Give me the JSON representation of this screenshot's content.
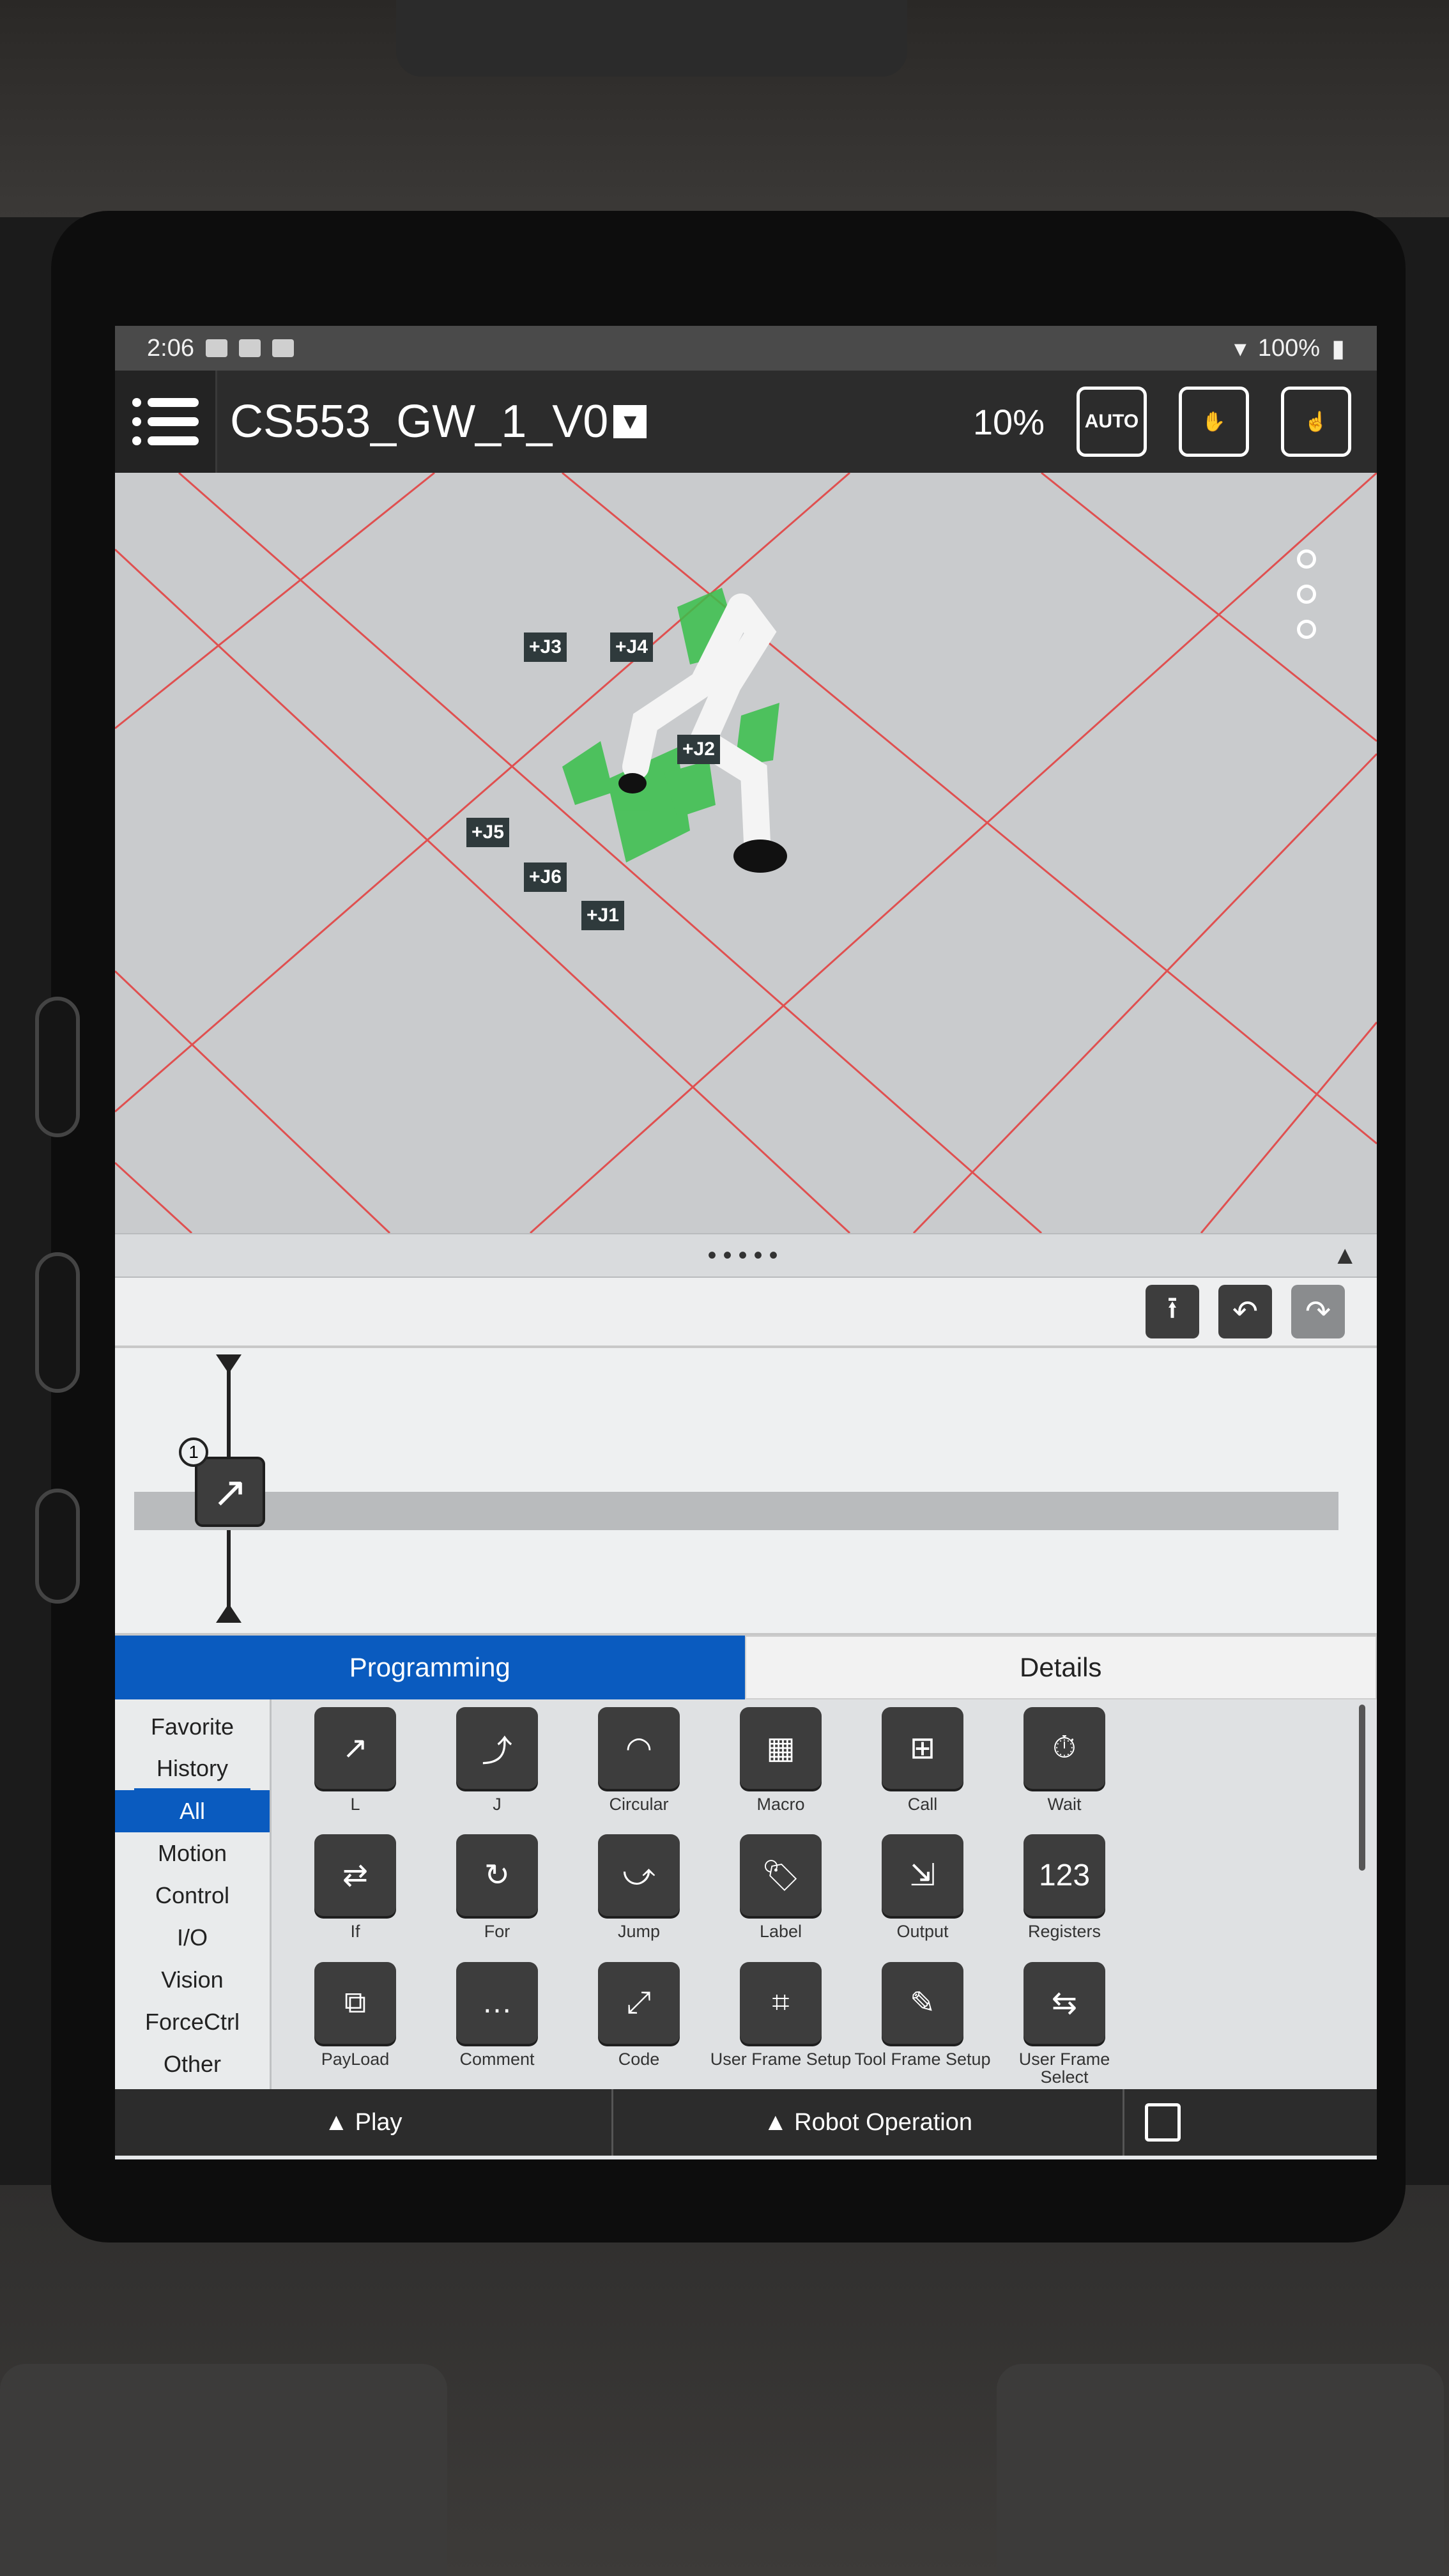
{
  "status_bar": {
    "time": "2:06",
    "battery": "100%"
  },
  "header": {
    "program_name": "CS553_GW_1_V0",
    "dropdown_glyph": "▼",
    "speed": "10%",
    "auto_label": "AUTO"
  },
  "view3d": {
    "joint_labels": [
      "+J3",
      "+J4",
      "+J2",
      "+J5",
      "+J6",
      "+J1"
    ],
    "grid_color": "#e05050",
    "robot_color": "#f2f2f2",
    "joint_zone_color": "#38c04a"
  },
  "splitter": {
    "grip": "•••••",
    "collapse_glyph": "▲"
  },
  "toolbar": {
    "upload_glyph": "⭱",
    "undo_glyph": "↶",
    "redo_glyph": "↷"
  },
  "timeline": {
    "step_number": "1",
    "step_glyph": "↗"
  },
  "tabs": {
    "programming": "Programming",
    "details": "Details"
  },
  "categories": [
    "Favorite",
    "History",
    "All",
    "Motion",
    "Control",
    "I/O",
    "Vision",
    "ForceCtrl",
    "Other"
  ],
  "selected_category": "All",
  "commands": [
    {
      "label": "L",
      "glyph": "↗"
    },
    {
      "label": "J",
      "glyph": "⤴"
    },
    {
      "label": "Circular",
      "glyph": "◠"
    },
    {
      "label": "Macro",
      "glyph": "▦"
    },
    {
      "label": "Call",
      "glyph": "⊞"
    },
    {
      "label": "Wait",
      "glyph": "⏱"
    },
    {
      "label": "If",
      "glyph": "⇄"
    },
    {
      "label": "For",
      "glyph": "↻"
    },
    {
      "label": "Jump",
      "glyph": "⤻"
    },
    {
      "label": "Label",
      "glyph": "🏷"
    },
    {
      "label": "Output",
      "glyph": "⇲"
    },
    {
      "label": "Registers",
      "glyph": "123"
    },
    {
      "label": "PayLoad",
      "glyph": "⧉"
    },
    {
      "label": "Comment",
      "glyph": "…"
    },
    {
      "label": "Code",
      "glyph": "⤢"
    },
    {
      "label": "User Frame Setup",
      "glyph": "⌗"
    },
    {
      "label": "Tool Frame Setup",
      "glyph": "✎"
    },
    {
      "label": "User Frame Select",
      "glyph": "⇆"
    }
  ],
  "bottom_bar": {
    "play": "▲ Play",
    "robot_operation": "▲ Robot Operation"
  }
}
